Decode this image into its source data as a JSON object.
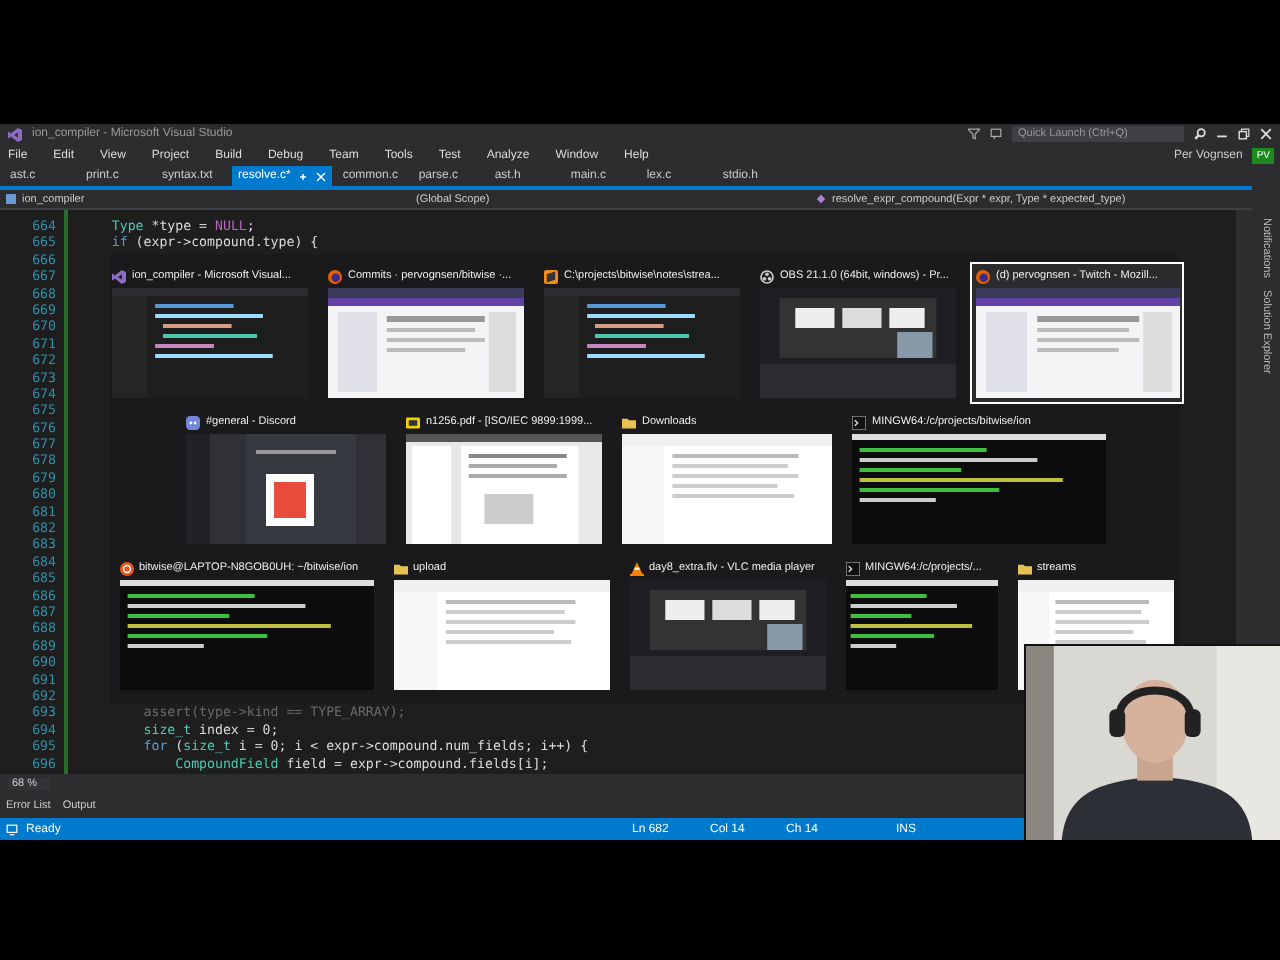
{
  "window": {
    "title": "ion_compiler - Microsoft Visual Studio",
    "quick_launch": {
      "placeholder": "Quick Launch (Ctrl+Q)"
    },
    "menu": [
      "File",
      "Edit",
      "View",
      "Project",
      "Build",
      "Debug",
      "Team",
      "Tools",
      "Test",
      "Analyze",
      "Window",
      "Help"
    ],
    "account": {
      "name": "Per Vognsen",
      "initials": "PV"
    }
  },
  "tabs": [
    {
      "label": "ast.c",
      "selected": false
    },
    {
      "label": "print.c",
      "selected": false
    },
    {
      "label": "syntax.txt",
      "selected": false
    },
    {
      "label": "resolve.c*",
      "selected": true
    },
    {
      "label": "common.c",
      "selected": false
    },
    {
      "label": "parse.c",
      "selected": false
    },
    {
      "label": "ast.h",
      "selected": false
    },
    {
      "label": "main.c",
      "selected": false
    },
    {
      "label": "lex.c",
      "selected": false
    },
    {
      "label": "stdio.h",
      "selected": false
    }
  ],
  "navigation": {
    "project": "ion_compiler",
    "scope": "(Global Scope)",
    "member": "resolve_expr_compound(Expr * expr, Type * expected_type)"
  },
  "editor": {
    "lines": [
      {
        "number": "664",
        "tokens": [
          {
            "text": "    Type",
            "kind": "type"
          },
          {
            "text": " *type = ",
            "kind": "plain"
          },
          {
            "text": "NULL",
            "kind": "macro"
          },
          {
            "text": ";",
            "kind": "plain"
          }
        ]
      },
      {
        "number": "665",
        "tokens": [
          {
            "text": "    if",
            "kind": "keyword"
          },
          {
            "text": " (expr->compound.type) {",
            "kind": "plain"
          }
        ]
      },
      {
        "number": "666"
      },
      {
        "number": "667"
      },
      {
        "number": "668"
      },
      {
        "number": "669"
      },
      {
        "number": "670"
      },
      {
        "number": "671"
      },
      {
        "number": "672"
      },
      {
        "number": "673"
      },
      {
        "number": "674"
      },
      {
        "number": "675"
      },
      {
        "number": "676"
      },
      {
        "number": "677"
      },
      {
        "number": "678"
      },
      {
        "number": "679"
      },
      {
        "number": "680"
      },
      {
        "number": "681"
      },
      {
        "number": "682"
      },
      {
        "number": "683"
      },
      {
        "number": "684"
      },
      {
        "number": "685"
      },
      {
        "number": "686"
      },
      {
        "number": "687"
      },
      {
        "number": "688"
      },
      {
        "number": "689"
      },
      {
        "number": "690"
      },
      {
        "number": "691"
      },
      {
        "number": "692"
      },
      {
        "number": "693",
        "tokens": [
          {
            "text": "        assert(type->kind == TYPE_ARRAY);",
            "kind": "dim"
          }
        ]
      },
      {
        "number": "694",
        "tokens": [
          {
            "text": "        size_t",
            "kind": "type"
          },
          {
            "text": " index = 0;",
            "kind": "plain"
          }
        ]
      },
      {
        "number": "695",
        "tokens": [
          {
            "text": "        for",
            "kind": "keyword"
          },
          {
            "text": " (",
            "kind": "plain"
          },
          {
            "text": "size_t",
            "kind": "type"
          },
          {
            "text": " i = 0; i < expr->compound.num_fields; i++) {",
            "kind": "plain"
          }
        ]
      },
      {
        "number": "696",
        "tokens": [
          {
            "text": "            CompoundField",
            "kind": "type"
          },
          {
            "text": " field = expr->compound.fields[i];",
            "kind": "plain"
          }
        ]
      }
    ],
    "zoom": "68 %"
  },
  "side_tabs": [
    "Notifications",
    "Solution Explorer"
  ],
  "task_switcher": {
    "rows": [
      [
        {
          "title": "ion_compiler - Microsoft Visual...",
          "kind": "vs",
          "selected": false
        },
        {
          "title": "Commits · pervognsen/bitwise ·...",
          "kind": "firefox",
          "selected": false
        },
        {
          "title": "C:\\projects\\bitwise\\notes\\strea...",
          "kind": "sublime",
          "selected": false
        },
        {
          "title": "OBS 21.1.0 (64bit, windows) - Pr...",
          "kind": "obs",
          "selected": false
        },
        {
          "title": "(d) pervognsen - Twitch - Mozill...",
          "kind": "firefox",
          "selected": true
        }
      ],
      [
        {
          "title": "#general - Discord",
          "kind": "discord",
          "selected": false
        },
        {
          "title": "n1256.pdf - [ISO/IEC 9899:1999...",
          "kind": "pdf",
          "selected": false
        },
        {
          "title": "Downloads",
          "kind": "folder",
          "selected": false
        },
        {
          "title": "MINGW64:/c/projects/bitwise/ion",
          "kind": "terminal",
          "selected": false
        }
      ],
      [
        {
          "title": "bitwise@LAPTOP-N8GOB0UH: ~/bitwise/ion",
          "kind": "ubuntu",
          "selected": false
        },
        {
          "title": "upload",
          "kind": "folder",
          "selected": false
        },
        {
          "title": "day8_extra.flv - VLC media player",
          "kind": "vlc",
          "selected": false
        },
        {
          "title": "MINGW64:/c/projects/...",
          "kind": "terminal",
          "selected": false
        },
        {
          "title": "streams",
          "kind": "folder",
          "selected": false
        }
      ]
    ]
  },
  "bottom_tabs": [
    "Error List",
    "Output"
  ],
  "status_bar": {
    "state": "Ready",
    "line": "Ln 682",
    "column": "Col 14",
    "char": "Ch 14",
    "mode": "INS"
  },
  "webcam": {
    "kind": "picture"
  }
}
